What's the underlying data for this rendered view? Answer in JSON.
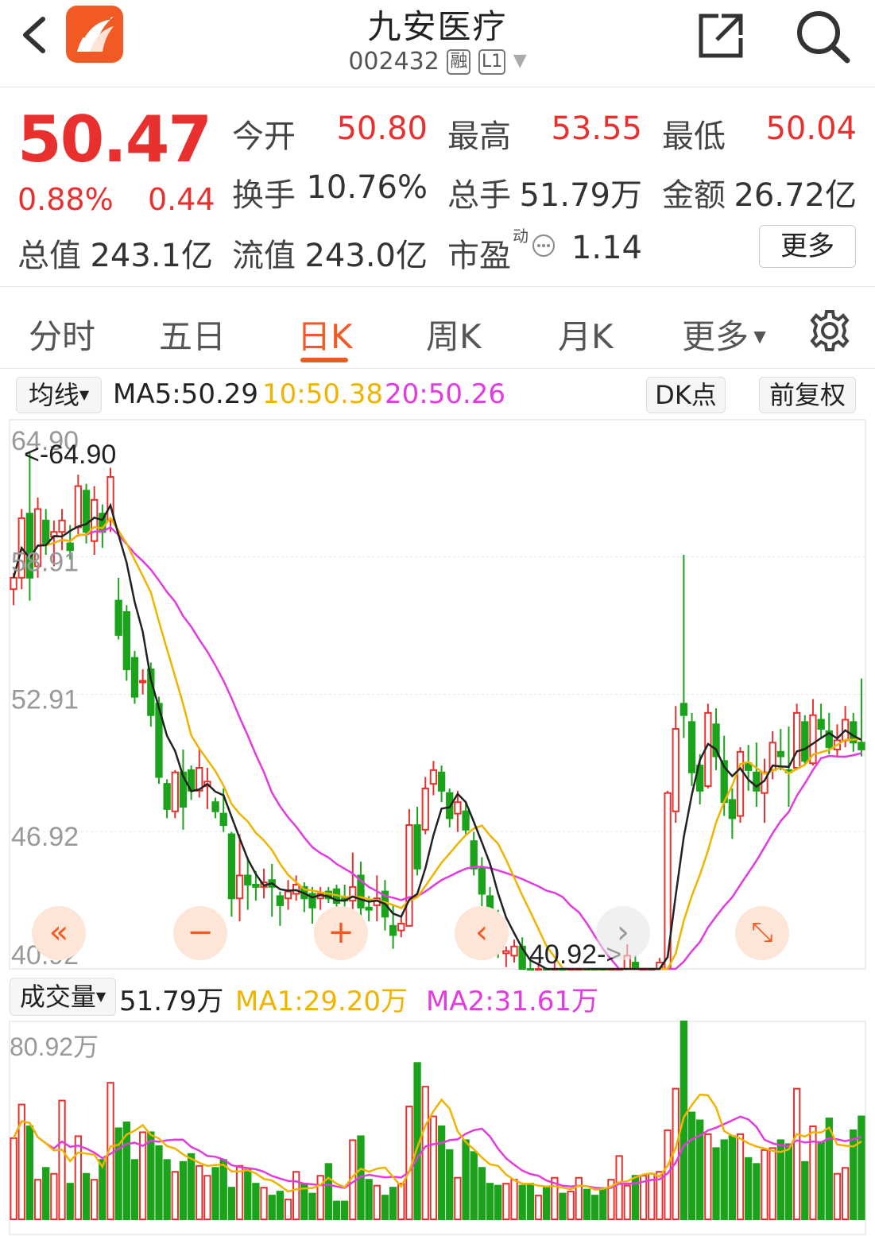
{
  "header": {
    "stock_name": "九安医疗",
    "code": "002432",
    "tag_margin": "融",
    "tag_level": "L1"
  },
  "quote": {
    "price": "50.47",
    "change_pct": "0.88%",
    "change": "0.44",
    "open_label": "今开",
    "open": "50.80",
    "high_label": "最高",
    "high": "53.55",
    "low_label": "最低",
    "low": "50.04",
    "turnover_label": "换手",
    "turnover": "10.76%",
    "volume_label": "总手",
    "volume": "51.79万",
    "amount_label": "金额",
    "amount": "26.72亿",
    "mktcap_label": "总值",
    "mktcap": "243.1亿",
    "float_label": "流值",
    "float": "243.0亿",
    "pe_label": "市盈",
    "pe_sup": "动",
    "pe": "1.14",
    "more": "更多"
  },
  "tabs": [
    {
      "label": "分时"
    },
    {
      "label": "五日"
    },
    {
      "label": "日K"
    },
    {
      "label": "周K"
    },
    {
      "label": "月K"
    },
    {
      "label": "更多"
    }
  ],
  "ma_bar": {
    "selector": "均线",
    "ma5": "MA5:50.29",
    "ma10": "10:50.38",
    "ma20": "20:50.26",
    "dk": "DK点",
    "adjust": "前复权"
  },
  "vol_bar": {
    "selector": "成交量",
    "vol": "51.79万",
    "ma1": "MA1:29.20万",
    "ma2": "MA2:31.61万"
  },
  "colors": {
    "up": "#e8312f",
    "down": "#1ba31b",
    "ma5": "#222222",
    "ma10": "#f0b400",
    "ma20": "#e23be0",
    "accent": "#f25a24"
  },
  "chart_data": {
    "type": "candlestick",
    "y_ticks": [
      "64.90",
      "58.91",
      "52.91",
      "46.92",
      "40.92"
    ],
    "ylim": [
      40.92,
      64.9
    ],
    "max_label": "<-64.90",
    "min_label": "40.92->",
    "vol_max_label": "80.92万",
    "ohlc": [
      [
        57.5,
        58.2,
        56.8,
        58.0
      ],
      [
        58.0,
        61.0,
        57.5,
        60.6
      ],
      [
        60.8,
        63.5,
        57.0,
        58.0
      ],
      [
        58.5,
        61.5,
        58.0,
        61.0
      ],
      [
        60.5,
        61.0,
        59.0,
        59.5
      ],
      [
        59.8,
        60.5,
        58.5,
        60.0
      ],
      [
        60.0,
        61.0,
        59.2,
        60.5
      ],
      [
        59.5,
        60.3,
        58.8,
        59.2
      ],
      [
        60.2,
        62.5,
        59.8,
        62.0
      ],
      [
        61.8,
        62.1,
        59.5,
        60.0
      ],
      [
        59.6,
        62.0,
        59.0,
        61.4
      ],
      [
        60.8,
        61.2,
        59.3,
        60.0
      ],
      [
        60.5,
        62.8,
        60.0,
        62.4
      ],
      [
        57.0,
        58.0,
        55.3,
        55.5
      ],
      [
        56.5,
        56.8,
        53.5,
        54.0
      ],
      [
        54.5,
        54.8,
        52.5,
        52.8
      ],
      [
        53.5,
        54.0,
        52.9,
        53.5
      ],
      [
        54.0,
        54.3,
        51.5,
        52.0
      ],
      [
        52.5,
        52.8,
        49.0,
        49.3
      ],
      [
        49.0,
        49.2,
        47.5,
        47.9
      ],
      [
        47.8,
        49.6,
        47.5,
        49.5
      ],
      [
        49.5,
        50.5,
        47.0,
        48.0
      ],
      [
        49.6,
        49.8,
        48.3,
        48.7
      ],
      [
        48.7,
        50.5,
        48.4,
        49.7
      ],
      [
        48.9,
        49.7,
        47.9,
        49.1
      ],
      [
        48.2,
        48.4,
        47.5,
        47.8
      ],
      [
        47.7,
        48.8,
        46.9,
        47.2
      ],
      [
        46.8,
        46.9,
        43.2,
        44.0
      ],
      [
        44.0,
        46.8,
        43.0,
        45.0
      ],
      [
        45.0,
        45.8,
        43.5,
        44.6
      ],
      [
        44.6,
        45.2,
        43.9,
        44.5
      ],
      [
        44.5,
        45.3,
        44.0,
        44.7
      ],
      [
        44.8,
        45.5,
        43.2,
        44.5
      ],
      [
        44.1,
        44.3,
        42.8,
        43.7
      ],
      [
        44.0,
        44.8,
        43.5,
        44.3
      ],
      [
        44.2,
        45.0,
        43.9,
        44.6
      ],
      [
        44.5,
        44.7,
        43.4,
        44.0
      ],
      [
        44.2,
        44.5,
        42.9,
        43.6
      ],
      [
        44.0,
        44.5,
        43.5,
        44.2
      ],
      [
        44.3,
        44.5,
        43.8,
        44.0
      ],
      [
        44.4,
        44.6,
        43.4,
        43.8
      ],
      [
        44.0,
        44.6,
        43.5,
        43.9
      ],
      [
        43.9,
        46.0,
        41.9,
        44.5
      ],
      [
        45.0,
        45.6,
        43.2,
        43.6
      ],
      [
        43.6,
        44.1,
        43.0,
        43.5
      ],
      [
        43.7,
        45.0,
        43.0,
        44.0
      ],
      [
        44.3,
        44.8,
        42.6,
        43.2
      ],
      [
        42.8,
        43.7,
        41.8,
        42.4
      ],
      [
        42.6,
        43.2,
        42.3,
        42.9
      ],
      [
        42.8,
        47.9,
        42.8,
        47.2
      ],
      [
        47.2,
        48.0,
        45.0,
        45.3
      ],
      [
        47.0,
        49.3,
        46.8,
        48.8
      ],
      [
        49.0,
        50.0,
        48.5,
        49.6
      ],
      [
        49.5,
        49.8,
        48.2,
        48.7
      ],
      [
        48.6,
        48.8,
        47.1,
        47.5
      ],
      [
        47.7,
        48.7,
        46.9,
        48.2
      ],
      [
        47.8,
        48.2,
        46.8,
        47.0
      ],
      [
        46.5,
        46.9,
        45.0,
        45.3
      ],
      [
        45.3,
        45.8,
        43.6,
        44.2
      ],
      [
        44.1,
        44.5,
        42.6,
        42.9
      ],
      [
        42.9,
        43.5,
        41.4,
        41.7
      ],
      [
        41.6,
        41.9,
        41.0,
        41.7
      ],
      [
        41.5,
        42.2,
        41.2,
        41.9
      ],
      [
        41.9,
        42.3,
        40.7,
        40.9
      ],
      [
        40.9,
        41.3,
        40.0,
        40.3
      ],
      [
        40.5,
        41.2,
        40.2,
        40.8
      ],
      [
        40.0,
        40.3,
        39.2,
        39.4
      ],
      [
        39.5,
        41.3,
        39.3,
        40.6
      ],
      [
        39.8,
        40.4,
        38.5,
        39.2
      ],
      [
        38.4,
        39.8,
        37.8,
        39.6
      ],
      [
        39.6,
        40.5,
        39.0,
        39.7
      ],
      [
        39.8,
        40.0,
        38.3,
        39.0
      ],
      [
        38.8,
        39.0,
        37.9,
        38.3
      ],
      [
        38.0,
        38.4,
        37.2,
        37.6
      ],
      [
        37.6,
        39.0,
        36.4,
        38.6
      ],
      [
        38.6,
        40.1,
        38.3,
        39.6
      ],
      [
        39.6,
        42.0,
        39.4,
        41.5
      ],
      [
        41.2,
        41.5,
        37.8,
        38.0
      ],
      [
        38.1,
        39.5,
        38.0,
        39.2
      ],
      [
        39.2,
        40.9,
        38.8,
        40.2
      ],
      [
        40.8,
        41.4,
        40.6,
        41.2
      ],
      [
        40.9,
        48.7,
        40.8,
        48.6
      ],
      [
        47.8,
        52.4,
        47.3,
        51.4
      ],
      [
        52.5,
        59.0,
        51.0,
        52.0
      ],
      [
        51.7,
        52.1,
        48.9,
        49.5
      ],
      [
        49.8,
        50.3,
        48.1,
        48.7
      ],
      [
        48.9,
        52.5,
        48.8,
        52.1
      ],
      [
        51.6,
        52.3,
        49.6,
        50.2
      ],
      [
        50.0,
        51.1,
        47.6,
        48.2
      ],
      [
        48.3,
        48.8,
        46.6,
        47.5
      ],
      [
        47.6,
        50.6,
        47.3,
        50.4
      ],
      [
        49.9,
        50.7,
        48.7,
        49.6
      ],
      [
        49.5,
        50.8,
        48.0,
        48.7
      ],
      [
        48.6,
        50.1,
        47.3,
        49.5
      ],
      [
        49.6,
        51.3,
        49.2,
        50.8
      ],
      [
        50.4,
        51.4,
        49.6,
        50.2
      ],
      [
        49.6,
        51.5,
        48.0,
        49.5
      ],
      [
        49.7,
        52.5,
        49.6,
        52.1
      ],
      [
        51.7,
        52.0,
        49.8,
        50.0
      ],
      [
        49.9,
        52.7,
        49.8,
        52.0
      ],
      [
        51.8,
        52.5,
        51.0,
        51.4
      ],
      [
        51.3,
        52.1,
        50.3,
        50.6
      ],
      [
        50.5,
        51.6,
        50.2,
        50.9
      ],
      [
        50.9,
        52.4,
        50.6,
        51.8
      ],
      [
        51.7,
        52.1,
        50.4,
        50.8
      ],
      [
        50.8,
        53.6,
        50.2,
        50.5
      ]
    ],
    "volume": [
      41,
      58,
      47,
      20,
      26,
      23,
      60,
      18,
      42,
      23,
      20,
      30,
      69,
      46,
      49,
      30,
      44,
      44,
      37,
      30,
      24,
      29,
      33,
      27,
      22,
      26,
      30,
      16,
      27,
      25,
      18,
      16,
      12,
      14,
      10,
      24,
      18,
      13,
      22,
      28,
      9,
      9,
      40,
      42,
      20,
      17,
      12,
      16,
      18,
      57,
      79,
      67,
      52,
      47,
      35,
      21,
      40,
      34,
      26,
      18,
      17,
      18,
      20,
      17,
      18,
      12,
      16,
      21,
      13,
      14,
      21,
      15,
      12,
      15,
      20,
      32,
      17,
      22,
      22,
      23,
      24,
      45,
      66,
      100,
      54,
      50,
      43,
      36,
      40,
      42,
      43,
      31,
      28,
      35,
      36,
      40,
      38,
      66,
      29,
      47,
      39,
      51,
      23,
      26,
      45,
      52
    ]
  }
}
